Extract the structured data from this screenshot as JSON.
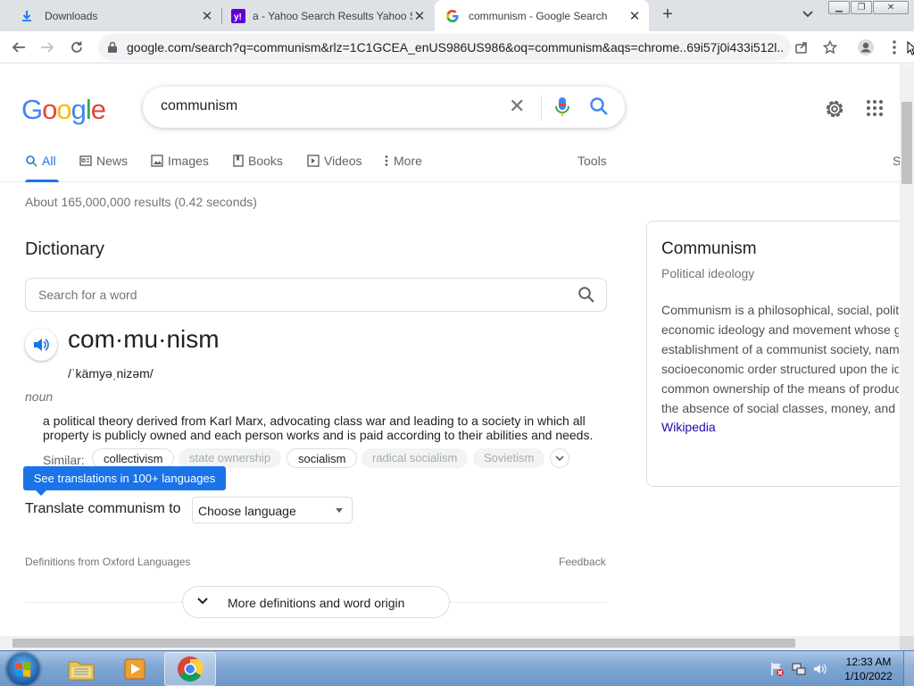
{
  "browser": {
    "tabs": [
      {
        "title": "Downloads",
        "icon": "download-icon"
      },
      {
        "title": "a - Yahoo Search Results Yahoo S",
        "icon": "yahoo-icon"
      },
      {
        "title": "communism - Google Search",
        "icon": "google-icon"
      }
    ],
    "active_tab": 2,
    "new_tab_label": "+",
    "url": "google.com/search?q=communism&rlz=1C1GCEA_enUS986US986&oq=communism&aqs=chrome..69i57j0i433i512l..."
  },
  "search": {
    "logo_letters": [
      "G",
      "o",
      "o",
      "g",
      "l",
      "e"
    ],
    "logo_colors": [
      "#4285f4",
      "#ea4335",
      "#fbbc05",
      "#4285f4",
      "#34a853",
      "#ea4335"
    ],
    "query": "communism",
    "nav": [
      {
        "label": "All",
        "icon": "search-icon"
      },
      {
        "label": "News",
        "icon": "news-icon"
      },
      {
        "label": "Images",
        "icon": "image-icon"
      },
      {
        "label": "Books",
        "icon": "book-icon"
      },
      {
        "label": "Videos",
        "icon": "video-icon"
      },
      {
        "label": "More",
        "icon": "more-vert-icon"
      }
    ],
    "tools_label": "Tools",
    "safe_label": "S",
    "stats": "About 165,000,000 results (0.42 seconds)"
  },
  "dictionary": {
    "heading": "Dictionary",
    "search_placeholder": "Search for a word",
    "headword": "com·mu·nism",
    "phonetic": "/ˈkämyəˌnizəm/",
    "part_of_speech": "noun",
    "definition": "a political theory derived from Karl Marx, advocating class war and leading to a society in which all property is publicly owned and each person works and is paid according to their abilities and needs.",
    "similar_label": "Similar:",
    "similar": [
      "collectivism",
      "state ownership",
      "socialism",
      "radical socialism",
      "Sovietism"
    ],
    "translations_banner": "See translations in 100+ languages",
    "translate_label": "Translate communism to",
    "language_select": "Choose language",
    "source": "Definitions from Oxford Languages",
    "feedback": "Feedback",
    "more_button": "More definitions and word origin"
  },
  "knowledge_panel": {
    "title": "Communism",
    "subtitle": "Political ideology",
    "description_lines": [
      "Communism is a philosophical, social, polit",
      "economic ideology and movement whose g",
      "establishment of a communist society, nam",
      "socioeconomic order structured upon the id",
      "common ownership of the means of produc",
      "the absence of social classes, money, and"
    ],
    "source": "Wikipedia"
  },
  "taskbar": {
    "apps": [
      "file-explorer-icon",
      "media-player-icon",
      "chrome-icon"
    ],
    "time": "12:33 AM",
    "date": "1/10/2022"
  }
}
